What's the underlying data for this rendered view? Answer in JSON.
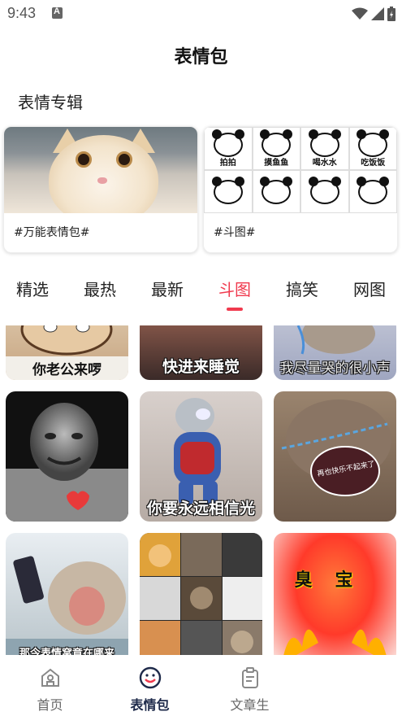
{
  "status": {
    "time": "9:43"
  },
  "header": {
    "title": "表情包"
  },
  "albums": {
    "section_title": "表情专辑",
    "items": [
      {
        "caption": "#万能表情包#"
      },
      {
        "caption": "#斗图#",
        "panel_labels": [
          "拍拍",
          "摸鱼鱼",
          "喝水水",
          "吃饭饭"
        ]
      }
    ]
  },
  "tabs": [
    {
      "label": "精选"
    },
    {
      "label": "最热"
    },
    {
      "label": "最新"
    },
    {
      "label": "斗图",
      "active": true
    },
    {
      "label": "搞笑"
    },
    {
      "label": "网图"
    }
  ],
  "grid": {
    "items": [
      {
        "caption": "你老公来啰"
      },
      {
        "caption": "快进来睡觉"
      },
      {
        "caption": "我尽量哭的很小声"
      },
      {
        "caption": ""
      },
      {
        "caption": "你要永远相信光"
      },
      {
        "caption": "再也快乐不起来了"
      },
      {
        "caption": "那今表情窝竟在哪来"
      },
      {
        "caption": ""
      },
      {
        "caption": "臭宝"
      }
    ]
  },
  "bottom_nav": {
    "items": [
      {
        "label": "首页",
        "icon": "home-icon"
      },
      {
        "label": "表情包",
        "icon": "smile-icon",
        "active": true
      },
      {
        "label": "文章生",
        "icon": "clipboard-icon"
      }
    ]
  },
  "colors": {
    "accent": "#f03a4e",
    "nav_active": "#1e2a4a"
  }
}
